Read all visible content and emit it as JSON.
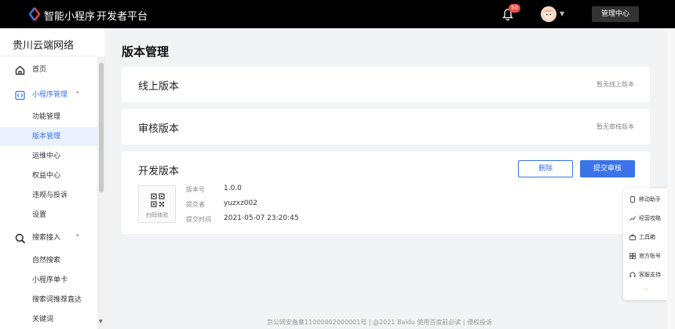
{
  "header": {
    "brand": "智能小程序",
    "platform": "开发者平台",
    "notification_count": "50",
    "admin_button": "管理中心"
  },
  "sidebar": {
    "org_name": "贵川云端网络",
    "items": [
      {
        "label": "首页",
        "kind": "top",
        "icon": "home-icon"
      },
      {
        "label": "小程序管理",
        "kind": "top",
        "icon": "miniapp-icon",
        "expanded": true
      },
      {
        "label": "功能管理",
        "kind": "sub"
      },
      {
        "label": "版本管理",
        "kind": "sub",
        "active": true
      },
      {
        "label": "运维中心",
        "kind": "sub"
      },
      {
        "label": "权益中心",
        "kind": "sub"
      },
      {
        "label": "违规与投诉",
        "kind": "sub"
      },
      {
        "label": "设置",
        "kind": "sub"
      },
      {
        "label": "搜索接入",
        "kind": "top",
        "icon": "search-icon",
        "expanded": true
      },
      {
        "label": "自然搜索",
        "kind": "sub"
      },
      {
        "label": "小程序单卡",
        "kind": "sub"
      },
      {
        "label": "搜索词推荐直达",
        "kind": "sub"
      },
      {
        "label": "关键词",
        "kind": "sub"
      }
    ]
  },
  "main": {
    "title": "版本管理",
    "online": {
      "title": "线上版本",
      "hint": "暂无线上版本"
    },
    "review": {
      "title": "审核版本",
      "hint": "暂无审核版本"
    },
    "dev": {
      "title": "开发版本",
      "delete_label": "删除",
      "submit_label": "提交审核",
      "qr_label": "扫码体验",
      "version_key": "版本号",
      "version_value": "1.0.0",
      "submitter_key": "提交者",
      "submitter_value": "yuzxz002",
      "time_key": "提交时间",
      "time_value": "2021-05-07 23:20:45"
    }
  },
  "assistant": {
    "items": [
      {
        "label": "移动助手",
        "icon": "mobile-icon"
      },
      {
        "label": "经营攻略",
        "icon": "chart-icon"
      },
      {
        "label": "工具箱",
        "icon": "toolbox-icon"
      },
      {
        "label": "官方账号",
        "icon": "grid-icon"
      },
      {
        "label": "客服支持",
        "icon": "headset-icon"
      }
    ]
  },
  "footer": {
    "text": "京公网安备案11000002000001号  |  @2021 Baidu 使用百度前必读  |  侵权投诉"
  },
  "colors": {
    "accent": "#3a74e8",
    "topbar": "#000000",
    "badge": "#f04b4b"
  }
}
